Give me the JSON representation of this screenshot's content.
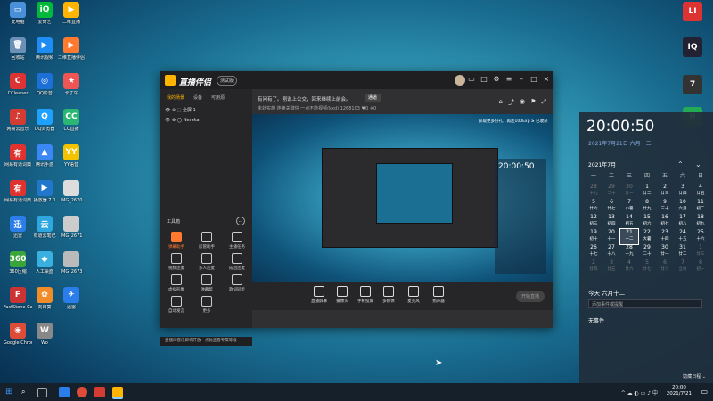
{
  "desktop_icons": [
    {
      "label": "此电脑",
      "color": "#4a90d9",
      "glyph": "▭"
    },
    {
      "label": "爱奇艺",
      "color": "#00b93b",
      "glyph": "iQ"
    },
    {
      "label": "二维直播",
      "color": "#ffb400",
      "glyph": "▶"
    },
    {
      "label": "回收站",
      "color": "#6b8fb5",
      "glyph": "🗑"
    },
    {
      "label": "腾讯视频",
      "color": "#1e8cf0",
      "glyph": "▶"
    },
    {
      "label": "二维直播伴侣",
      "color": "#ff7a2f",
      "glyph": "▶"
    },
    {
      "label": "CCleaner",
      "color": "#d33",
      "glyph": "C"
    },
    {
      "label": "QQ影音",
      "color": "#1d6fd8",
      "glyph": "◎"
    },
    {
      "label": "卡丁车",
      "color": "#e55",
      "glyph": "★"
    },
    {
      "label": "网易云音乐",
      "color": "#d43c33",
      "glyph": "♫"
    },
    {
      "label": "QQ浏览器",
      "color": "#1ea0ff",
      "glyph": "Q"
    },
    {
      "label": "CC直播",
      "color": "#2cb673",
      "glyph": "CC"
    },
    {
      "label": "网易有道词典",
      "color": "#e0322e",
      "glyph": "有"
    },
    {
      "label": "腾讯手游",
      "color": "#3b87f5",
      "glyph": "▲"
    },
    {
      "label": "YY语音",
      "color": "#f4c300",
      "glyph": "YY"
    },
    {
      "label": "网易有道词典",
      "color": "#e0322e",
      "glyph": "有"
    },
    {
      "label": "播放器 7.0",
      "color": "#2277cc",
      "glyph": "▶"
    },
    {
      "label": "IMG_2670",
      "color": "#dddddd",
      "glyph": ""
    },
    {
      "label": "迅雷",
      "color": "#2b7de9",
      "glyph": "迅"
    },
    {
      "label": "有道云笔记",
      "color": "#2ea7e0",
      "glyph": "云"
    },
    {
      "label": "IMG_2671",
      "color": "#cccccc",
      "glyph": ""
    },
    {
      "label": "360压缩",
      "color": "#3aa53a",
      "glyph": "360"
    },
    {
      "label": "人工桌面",
      "color": "#3ab0e0",
      "glyph": "◆"
    },
    {
      "label": "IMG_2673",
      "color": "#bbbbbb",
      "glyph": ""
    },
    {
      "label": "FastStone Capture",
      "color": "#c33",
      "glyph": "F"
    },
    {
      "label": "向日葵",
      "color": "#f28c28",
      "glyph": "✿"
    },
    {
      "label": "迅雷",
      "color": "#2b7de9",
      "glyph": "✈"
    },
    {
      "label": "Google Chrome",
      "color": "#dd4b39",
      "glyph": "◉"
    },
    {
      "label": "Wo",
      "color": "#888888",
      "glyph": "W"
    }
  ],
  "right_icons": [
    {
      "label": "",
      "color": "#d33",
      "glyph": "LI"
    },
    {
      "label": "",
      "color": "#223",
      "glyph": "IQ"
    },
    {
      "label": "",
      "color": "#333",
      "glyph": "7"
    },
    {
      "label": "",
      "color": "#2a5",
      "glyph": "H"
    }
  ],
  "app": {
    "title": "直播伴侣",
    "badge": "测试版",
    "left_tabs": [
      "我的场景",
      "设备",
      "可用源"
    ],
    "scenes": [
      "全屏 1",
      "Nereka"
    ],
    "tools_title": "工具箱",
    "tools": [
      "弹幕助手",
      "房管助手",
      "主播任务",
      "视频连麦",
      "多人连麦",
      "成团连麦",
      "虚拟形象",
      "弹幕帮",
      "歌词同步",
      "自动发言",
      "更多"
    ],
    "notice": "有问有了。刚说上公交，回来继续上前会。",
    "notice_btn": "通道",
    "stats": "未处实施  连续关键信  一点不能视频(kxd)  1268103  ♥0  ✈0",
    "bottom_buttons": [
      "直播屏幕",
      "摄像头",
      "手机投屏",
      "多媒体",
      "麦克风",
      "扬声器"
    ],
    "go_live": "开始直播",
    "status": "直播间音乐即将开放 · 点此查看专属等级"
  },
  "preview": {
    "clock": "20:00:50",
    "tag": "获取更多好礼，再连100Exp ≥ 已收获"
  },
  "calendar": {
    "time": "20:00:50",
    "date": "2021年7月21日 六月十二",
    "month": "2021年7月",
    "weekdays": [
      "一",
      "二",
      "三",
      "四",
      "五",
      "六",
      "日"
    ],
    "weeks": [
      [
        {
          "d": "28",
          "s": "十九",
          "m": true
        },
        {
          "d": "29",
          "s": "二十",
          "m": true
        },
        {
          "d": "30",
          "s": "廿一",
          "m": true
        },
        {
          "d": "1",
          "s": "廿二"
        },
        {
          "d": "2",
          "s": "廿三"
        },
        {
          "d": "3",
          "s": "廿四"
        },
        {
          "d": "4",
          "s": "廿五"
        }
      ],
      [
        {
          "d": "5",
          "s": "廿六"
        },
        {
          "d": "6",
          "s": "廿七"
        },
        {
          "d": "7",
          "s": "小暑"
        },
        {
          "d": "8",
          "s": "廿九"
        },
        {
          "d": "9",
          "s": "三十"
        },
        {
          "d": "10",
          "s": "六月"
        },
        {
          "d": "11",
          "s": "初二"
        }
      ],
      [
        {
          "d": "12",
          "s": "初三"
        },
        {
          "d": "13",
          "s": "初四"
        },
        {
          "d": "14",
          "s": "初五"
        },
        {
          "d": "15",
          "s": "初六"
        },
        {
          "d": "16",
          "s": "初七"
        },
        {
          "d": "17",
          "s": "初八"
        },
        {
          "d": "18",
          "s": "初九"
        }
      ],
      [
        {
          "d": "19",
          "s": "初十"
        },
        {
          "d": "20",
          "s": "十一"
        },
        {
          "d": "21",
          "s": "十二",
          "t": true
        },
        {
          "d": "22",
          "s": "大暑"
        },
        {
          "d": "23",
          "s": "十四"
        },
        {
          "d": "24",
          "s": "十五"
        },
        {
          "d": "25",
          "s": "十六"
        }
      ],
      [
        {
          "d": "26",
          "s": "十七"
        },
        {
          "d": "27",
          "s": "十八"
        },
        {
          "d": "28",
          "s": "十九"
        },
        {
          "d": "29",
          "s": "二十"
        },
        {
          "d": "30",
          "s": "廿一"
        },
        {
          "d": "31",
          "s": "廿二"
        },
        {
          "d": "1",
          "s": "廿三",
          "m": true
        }
      ],
      [
        {
          "d": "2",
          "s": "廿四",
          "m": true
        },
        {
          "d": "3",
          "s": "廿五",
          "m": true
        },
        {
          "d": "4",
          "s": "廿六",
          "m": true
        },
        {
          "d": "5",
          "s": "廿七",
          "m": true
        },
        {
          "d": "6",
          "s": "廿八",
          "m": true
        },
        {
          "d": "7",
          "s": "立秋",
          "m": true
        },
        {
          "d": "8",
          "s": "初一",
          "m": true
        }
      ]
    ],
    "today_label": "今天 六月十二",
    "event_placeholder": "添加事件或提醒",
    "no_events": "无事件",
    "hide": "隐藏日程 ⌄"
  },
  "taskbar": {
    "clock_time": "20:00",
    "clock_date": "2021/7/21",
    "tray": "^ ☁ ◐ ▭ ♪ 中"
  }
}
